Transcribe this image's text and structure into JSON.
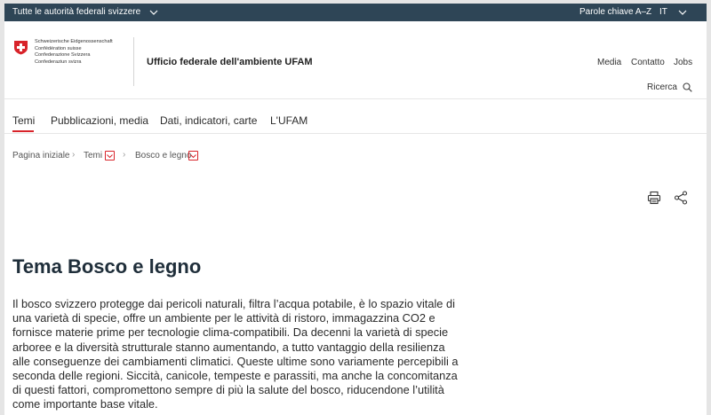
{
  "topbar": {
    "authorities_label": "Tutte le autorità federali svizzere",
    "keywords_label": "Parole chiave A–Z",
    "language_label": "IT"
  },
  "header": {
    "confederation_lines": [
      "Schweizerische Eidgenossenschaft",
      "Confédération suisse",
      "Confederazione Svizzera",
      "Confederaziun svizra"
    ],
    "office_name": "Ufficio federale dell'ambiente UFAM",
    "meta_nav": [
      "Media",
      "Contatto",
      "Jobs"
    ],
    "search_label": "Ricerca"
  },
  "main_nav": {
    "items": [
      "Temi",
      "Pubblicazioni, media",
      "Dati, indicatori, carte",
      "L'UFAM"
    ],
    "active": "Temi"
  },
  "breadcrumb": [
    "Pagina iniziale",
    "Temi",
    "Bosco e legno"
  ],
  "content": {
    "title": "Tema Bosco e legno",
    "lead": "Il bosco svizzero protegge dai pericoli naturali, filtra l’acqua potabile, è lo spazio vitale di una varietà di specie, offre un ambiente per le attività di ristoro, immagazzina CO2 e fornisce materie prime per tecnologie clima-compatibili. Da decenni la varietà di specie arboree e la diversità strutturale stanno aumentando, a tutto vantaggio della resilienza alle conseguenze dei cambiamenti climatici. Queste ultime sono variamente percepibili a seconda delle regioni. Siccità, canicole, tempeste e parassiti, ma anche la concomitanza di questi fattori, compromettono sempre di più la salute del bosco, riducendone l’utilità come importante base vitale."
  },
  "icons": [
    "chevron-down-icon",
    "swiss-flag-icon",
    "search-icon",
    "print-icon",
    "share-icon"
  ],
  "colors": {
    "topbar_bg": "#2e4556",
    "accent_red": "#d8232a",
    "title_color": "#1f2e3a"
  }
}
